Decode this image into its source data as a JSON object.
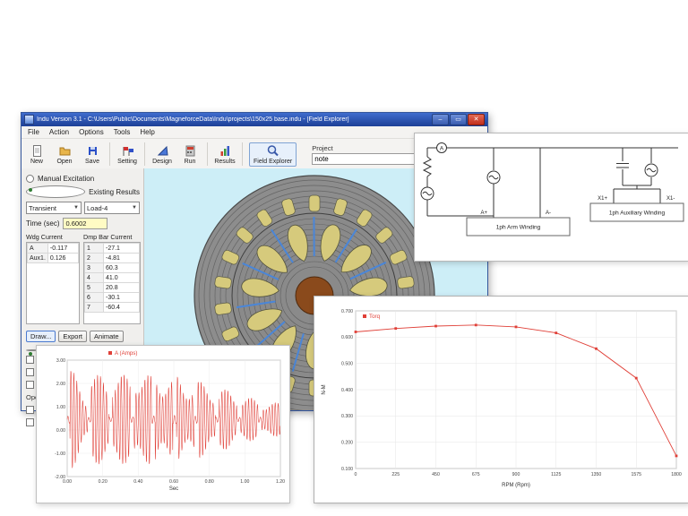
{
  "window": {
    "title": "Indu Version 3.1 - C:\\Users\\Public\\Documents\\MagneforceData\\Indu\\projects\\150x25 base.indu - [Field Explorer]",
    "menus": [
      "File",
      "Action",
      "Options",
      "Tools",
      "Help"
    ],
    "controls": {
      "minimize": "–",
      "maximize": "▭",
      "close": "✕"
    },
    "toolbar": {
      "buttons": [
        "New",
        "Open",
        "Save",
        "Setting",
        "Design",
        "Run",
        "Results",
        "Field Explorer"
      ],
      "project_label": "Project",
      "project_value": "note"
    }
  },
  "panel": {
    "manual_excitation_label": "Manual Excitation",
    "existing_results_label": "Existing Results",
    "mode_value": "Transient",
    "load_value": "Load-4",
    "time_label": "Time (sec)",
    "time_value": "0.6002",
    "wdg_table": {
      "header": "Wdg Current",
      "rows": [
        [
          "A",
          "-0.117"
        ],
        [
          "Aux1.",
          "0.126"
        ]
      ]
    },
    "dmp_table": {
      "header": "Dmp Bar Current",
      "rows": [
        [
          "1",
          "-27.1"
        ],
        [
          "2",
          "-4.81"
        ],
        [
          "3",
          "60.3"
        ],
        [
          "4",
          "41.0"
        ],
        [
          "5",
          "20.8"
        ],
        [
          "6",
          "-30.1"
        ],
        [
          "7",
          "-60.4"
        ]
      ]
    },
    "buttons": [
      "Draw...",
      "Export",
      "Animate"
    ],
    "partial_label": "Ope"
  },
  "circuit": {
    "ammeter_label": "A",
    "arm_winding_label": "1ph Arm Winding",
    "aux_winding_label": "1ph Auxiliary Winding",
    "terminal_a_plus": "A+",
    "terminal_a_minus": "A-",
    "terminal_x1_plus": "X1+",
    "terminal_x1_minus": "X1-"
  },
  "chart_data": [
    {
      "type": "line",
      "title": "",
      "legend": "A (Amps)",
      "color": "#e04038",
      "xlabel": "Sec",
      "ylabel": "",
      "xlim": [
        0,
        1.2
      ],
      "ylim": [
        -2,
        3
      ],
      "xticks": [
        0,
        0.2,
        0.4,
        0.6,
        0.8,
        1.0,
        1.2
      ],
      "xtick_labels": [
        "0.00",
        "0.20",
        "0.40",
        "0.60",
        "0.80",
        "1.00",
        "1.20"
      ],
      "yticks": [
        3,
        2,
        1,
        0,
        -1,
        -2
      ],
      "ytick_labels": [
        "3.00",
        "2.00",
        "1.00",
        "0.00",
        "-1.00",
        "-2.00"
      ],
      "baseline": 0.45,
      "quiet_amplitude": 0.18,
      "frequency_hz": 60,
      "bursts": [
        [
          0.015,
          0.115,
          2.3
        ],
        [
          0.135,
          0.235,
          2.1
        ],
        [
          0.255,
          0.355,
          2.2
        ],
        [
          0.375,
          0.475,
          2.3
        ],
        [
          0.495,
          0.595,
          2.15
        ],
        [
          0.615,
          0.715,
          1.95
        ],
        [
          0.735,
          0.835,
          1.7
        ],
        [
          0.855,
          0.955,
          1.4
        ],
        [
          0.975,
          1.075,
          1.05
        ],
        [
          1.095,
          1.2,
          0.85
        ]
      ]
    },
    {
      "type": "line",
      "legend": "Torq",
      "color": "#e04038",
      "xlabel": "RPM (Rpm)",
      "ylabel": "N-M",
      "xlim": [
        0,
        1800
      ],
      "ylim": [
        0.1,
        0.7
      ],
      "xticks": [
        0,
        225,
        450,
        675,
        900,
        1125,
        1350,
        1575,
        1800
      ],
      "xtick_labels": [
        "0",
        "225",
        "450",
        "675",
        "900",
        "1125",
        "1350",
        "1575",
        "1800"
      ],
      "yticks": [
        0.7,
        0.6,
        0.5,
        0.4,
        0.3,
        0.2,
        0.1
      ],
      "ytick_labels": [
        "0.700",
        "0.600",
        "0.500",
        "0.400",
        "0.300",
        "0.200",
        "0.100"
      ],
      "x": [
        0,
        225,
        450,
        675,
        900,
        1125,
        1350,
        1575,
        1800
      ],
      "y": [
        0.62,
        0.633,
        0.642,
        0.646,
        0.639,
        0.616,
        0.556,
        0.444,
        0.148
      ]
    }
  ]
}
